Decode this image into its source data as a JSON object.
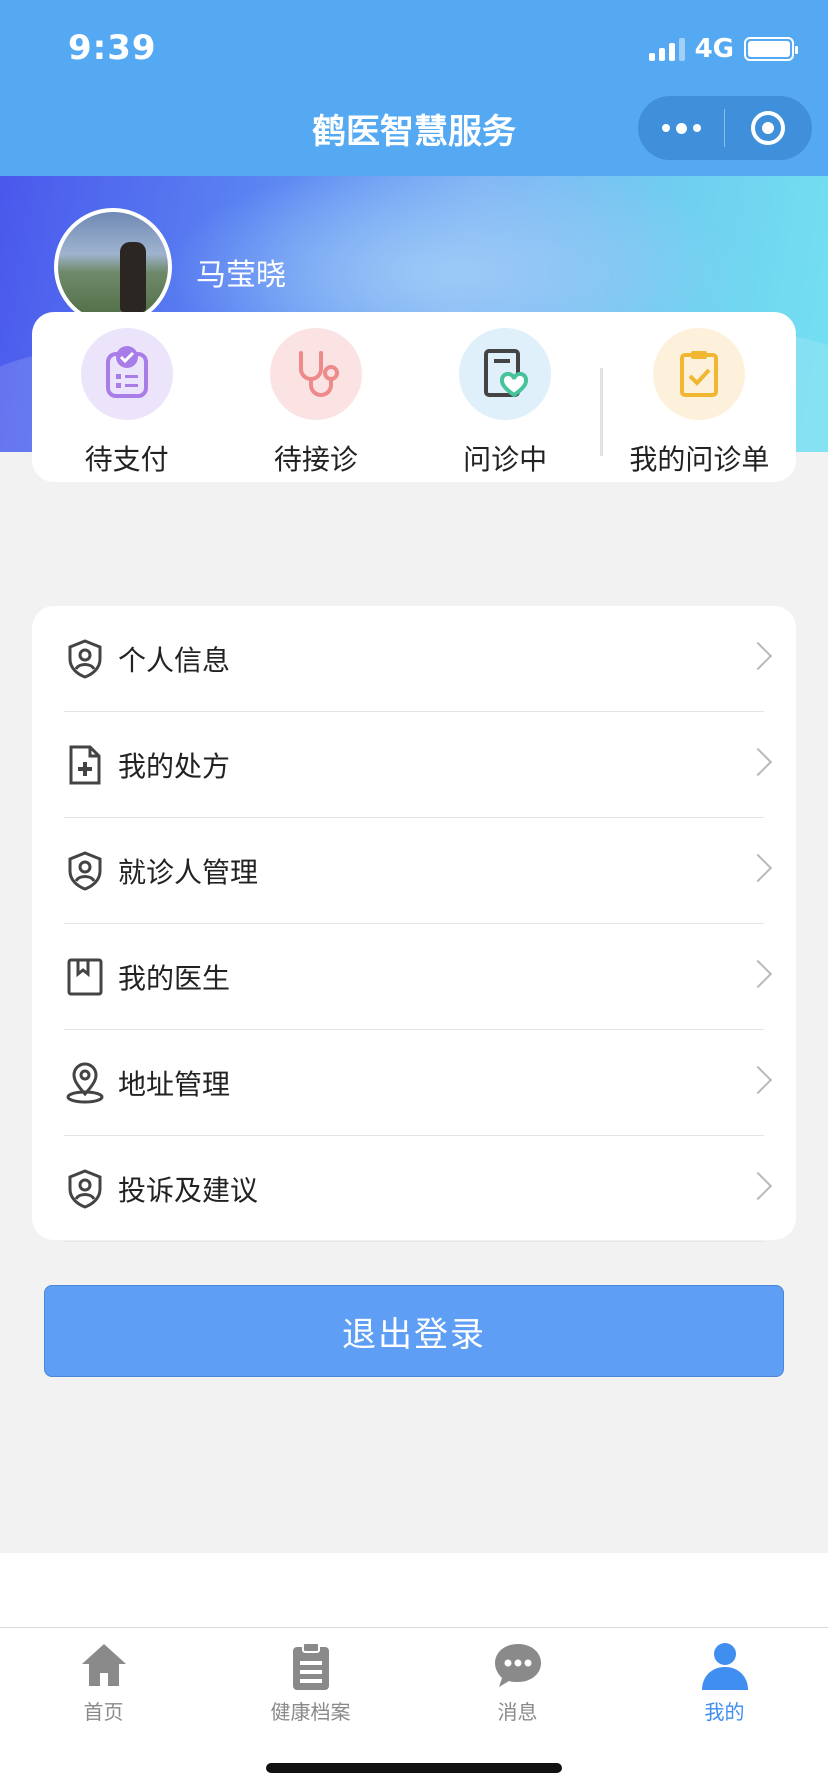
{
  "status_bar": {
    "time": "9:39",
    "network": "4G"
  },
  "nav": {
    "title": "鹤医智慧服务",
    "more_icon": "more-dots-icon",
    "close_icon": "target-circle-icon"
  },
  "profile": {
    "username": "马莹晓"
  },
  "orders": [
    {
      "label": "待支付",
      "icon": "payment-clipboard-icon",
      "bg": "#ece4fb",
      "color": "#a97de8"
    },
    {
      "label": "待接诊",
      "icon": "stethoscope-icon",
      "bg": "#fbe3e3",
      "color": "#ee8a8a"
    },
    {
      "label": "问诊中",
      "icon": "heart-document-icon",
      "bg": "#dff0fb",
      "color": "#46c39a"
    },
    {
      "label": "我的问诊单",
      "icon": "checklist-clipboard-icon",
      "bg": "#fdf1dc",
      "color": "#f1b733"
    }
  ],
  "menu": [
    {
      "label": "个人信息",
      "icon": "shield-person-icon"
    },
    {
      "label": "我的处方",
      "icon": "document-plus-icon"
    },
    {
      "label": "就诊人管理",
      "icon": "shield-person-icon"
    },
    {
      "label": "我的医生",
      "icon": "bookmark-icon"
    },
    {
      "label": "地址管理",
      "icon": "location-pin-icon"
    },
    {
      "label": "投诉及建议",
      "icon": "shield-person-icon"
    }
  ],
  "logout_label": "退出登录",
  "tabbar": [
    {
      "label": "首页",
      "icon": "home-icon",
      "active": false
    },
    {
      "label": "健康档案",
      "icon": "clipboard-icon",
      "active": false
    },
    {
      "label": "消息",
      "icon": "chat-bubble-icon",
      "active": false
    },
    {
      "label": "我的",
      "icon": "user-icon",
      "active": true
    }
  ],
  "colors": {
    "header": "#55a9f2",
    "primary_button": "#5e9ef4",
    "tab_active": "#3f8ef0",
    "tab_inactive": "#8a8a8a"
  }
}
